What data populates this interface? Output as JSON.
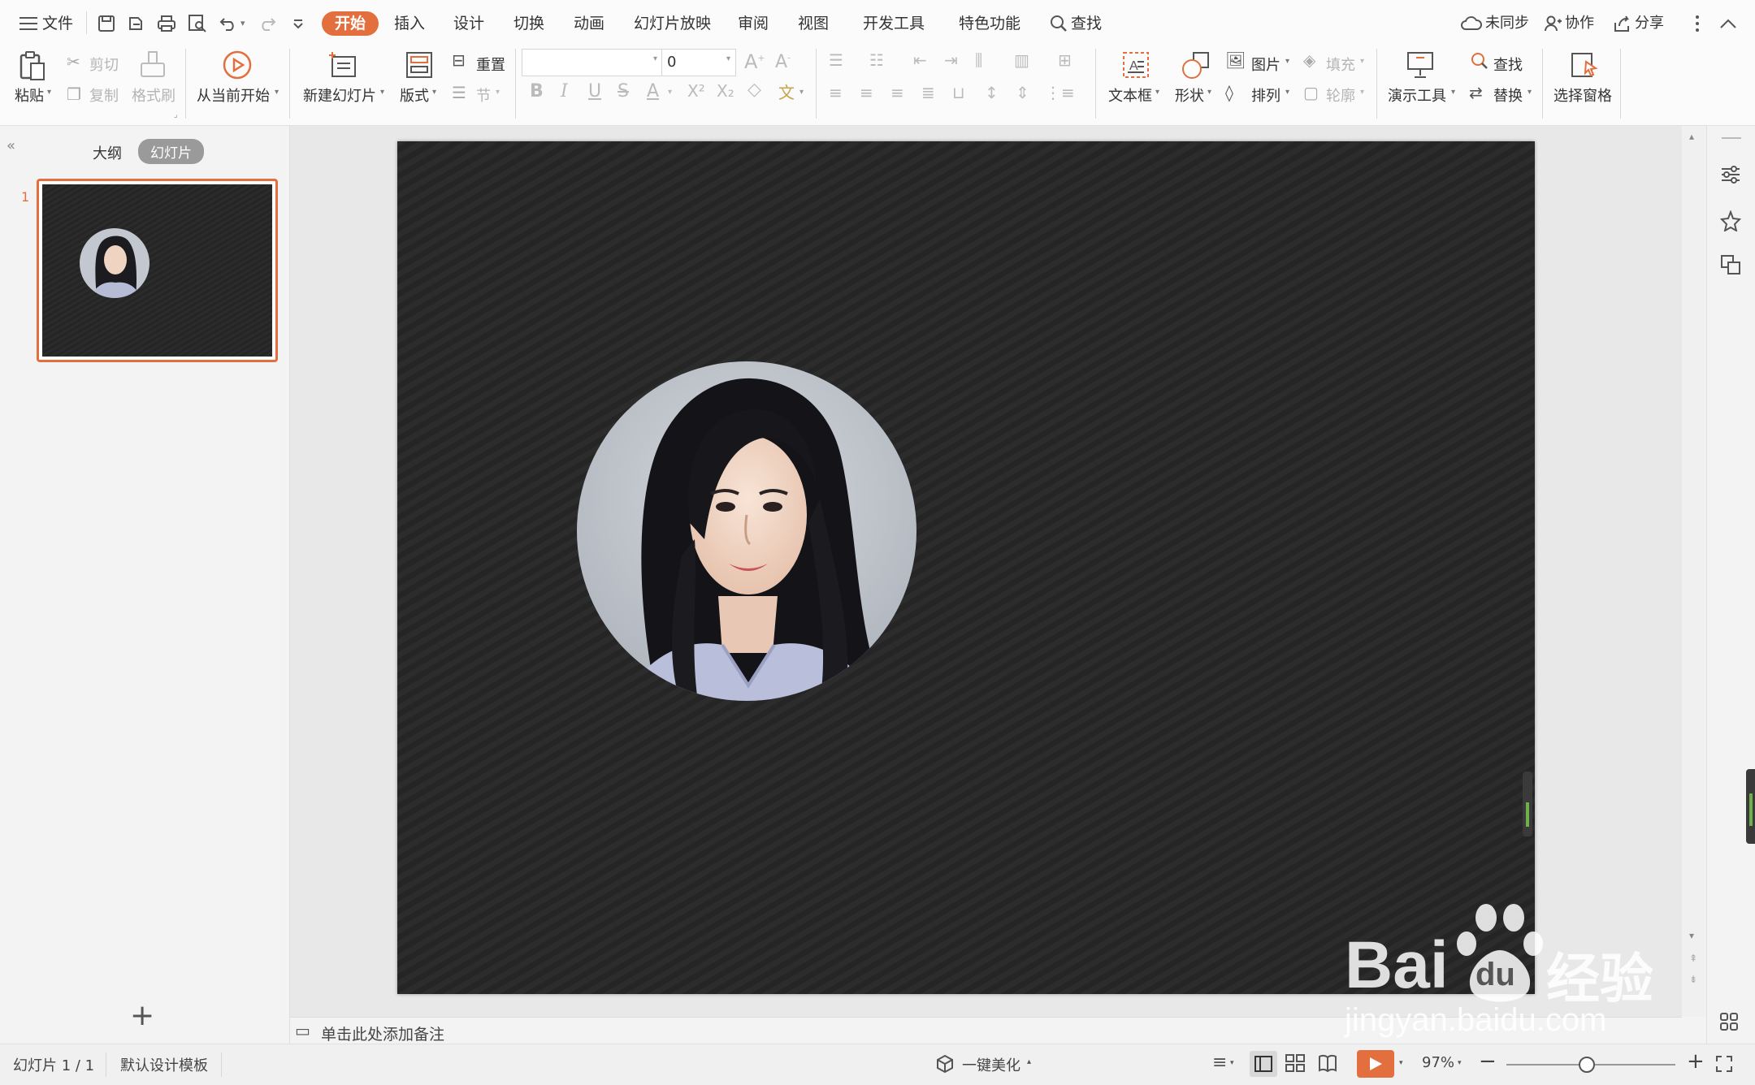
{
  "menu": {
    "file_label": "文件",
    "tabs": [
      {
        "label": "开始",
        "active": true
      },
      {
        "label": "插入"
      },
      {
        "label": "设计"
      },
      {
        "label": "切换"
      },
      {
        "label": "动画"
      },
      {
        "label": "幻灯片放映"
      },
      {
        "label": "审阅"
      },
      {
        "label": "视图"
      },
      {
        "label": "开发工具"
      },
      {
        "label": "特色功能"
      }
    ],
    "search_label": "查找",
    "sync_label": "未同步",
    "collab_label": "协作",
    "share_label": "分享"
  },
  "ribbon": {
    "paste": "粘贴",
    "cut": "剪切",
    "copy": "复制",
    "format_painter": "格式刷",
    "play_from_current": "从当前开始",
    "new_slide": "新建幻灯片",
    "layout": "版式",
    "reset": "重置",
    "section": "节",
    "font_name_value": "",
    "font_size_value": "0",
    "bold": "B",
    "italic": "I",
    "underline": "U",
    "strike": "S",
    "font_color": "A",
    "textbox": "文本框",
    "shape": "形状",
    "picture": "图片",
    "fill": "填充",
    "arrange": "排列",
    "outline": "轮廓",
    "present_tools": "演示工具",
    "find": "查找",
    "replace": "替换",
    "select_pane": "选择窗格"
  },
  "left_panel": {
    "tab_outline": "大纲",
    "tab_slides": "幻灯片",
    "slide_number": "1"
  },
  "notes": {
    "placeholder": "单击此处添加备注"
  },
  "status": {
    "slide_info": "幻灯片 1 / 1",
    "template": "默认设计模板",
    "beautify": "一键美化",
    "zoom": "97%"
  },
  "watermark": {
    "brand": "Bai",
    "brand2": "du",
    "cn": "经验",
    "url": "jingyan.baidu.com"
  },
  "colors": {
    "accent": "#e26f3d",
    "slide_bg": "#252525"
  }
}
